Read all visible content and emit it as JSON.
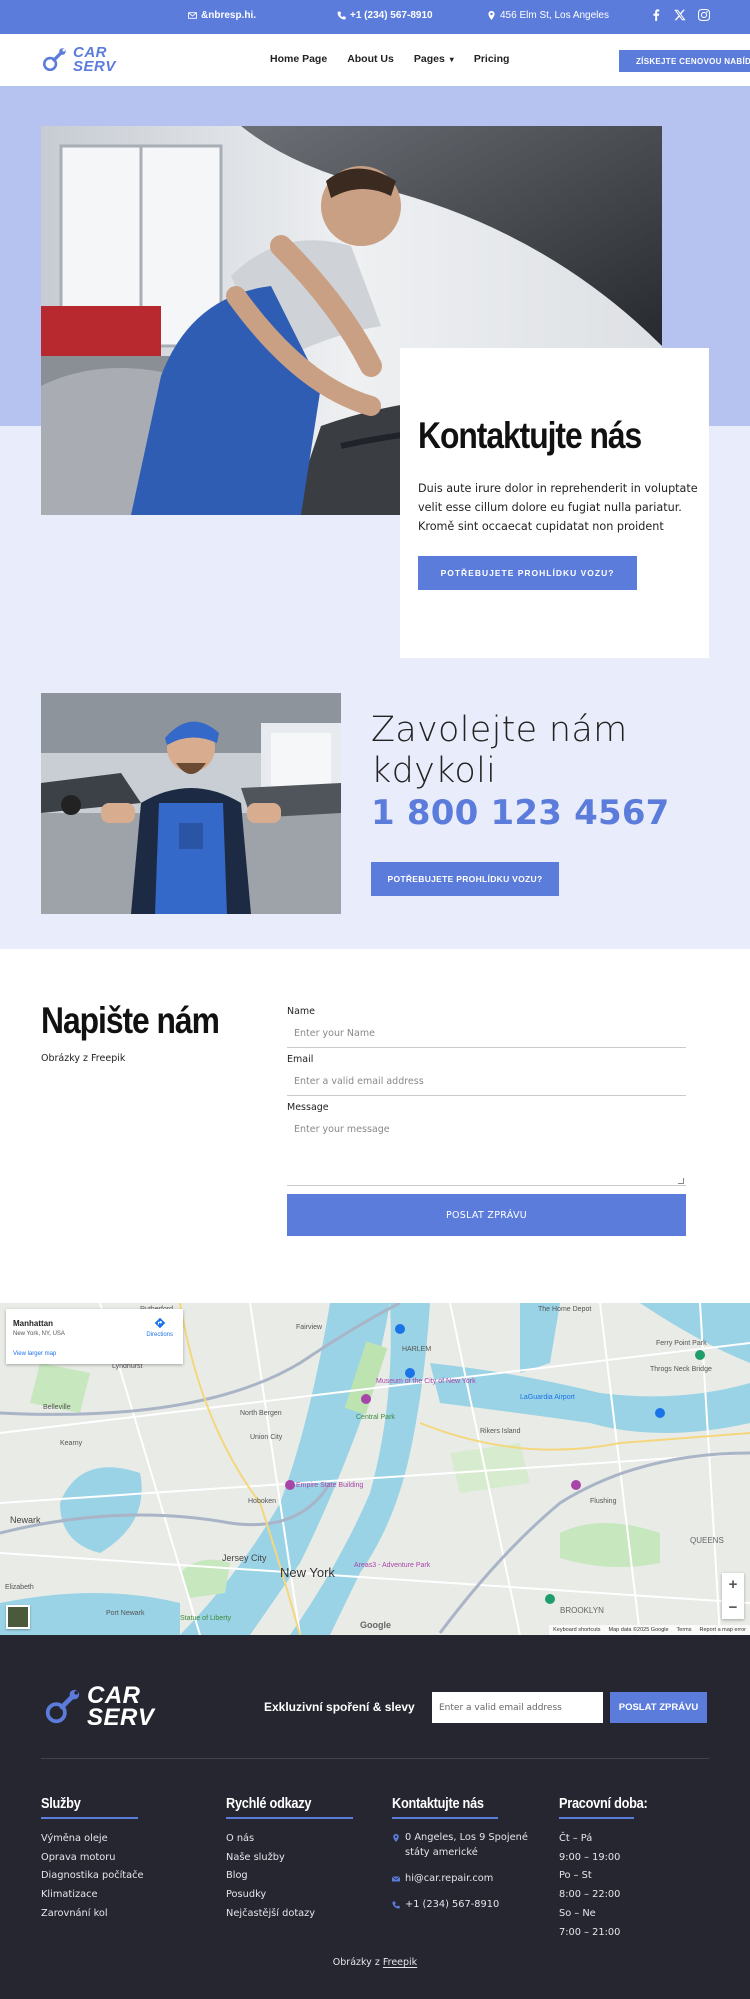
{
  "colors": {
    "accent": "#5c7cdb",
    "hero_band": "#b6c3f0",
    "light_band": "#e9edfb",
    "footer_bg": "#25262f"
  },
  "topbar": {
    "email": "&nbresp.hi.",
    "phone": "+1 (234) 567-8910",
    "address": "456 Elm St, Los Angeles",
    "social": [
      "facebook-icon",
      "x-icon",
      "instagram-icon"
    ]
  },
  "header": {
    "logo_line1": "CAR",
    "logo_line2": "SERV",
    "nav": [
      {
        "label": "Home Page"
      },
      {
        "label": "About Us"
      },
      {
        "label": "Pages",
        "has_dropdown": true
      },
      {
        "label": "Pricing"
      }
    ],
    "cta_label": "ZÍSKEJTE CENOVOU NABÍDKU"
  },
  "hero": {
    "title": "Kontaktujte nás",
    "text": "Duis aute irure dolor in reprehenderit in voluptate velit esse cillum dolore eu fugiat nulla pariatur. Kromě sint occaecat cupidatat non proident",
    "button": "POTŘEBUJETE PROHLÍDKU VOZU?"
  },
  "call": {
    "title_line1": "Zavolejte nám",
    "title_line2": "kdykoli",
    "phone": "1 800 123 4567",
    "button": "POTŘEBUJETE PROHLÍDKU VOZU?"
  },
  "write": {
    "title": "Napište nám",
    "credit": "Obrázky z Freepik",
    "form": {
      "name_label": "Name",
      "name_placeholder": "Enter your Name",
      "email_label": "Email",
      "email_placeholder": "Enter a valid email address",
      "message_label": "Message",
      "message_placeholder": "Enter your message",
      "submit": "POSLAT ZPRÁVU"
    }
  },
  "map": {
    "card_title": "Manhattan",
    "card_subtitle": "New York, NY, USA",
    "card_link": "View larger map",
    "directions": "Directions",
    "labels": [
      "Rutherford",
      "Fairview",
      "HARLEM",
      "The Home Depot",
      "Ferry Point Park",
      "Lyndhurst",
      "Belleville",
      "North Bergen",
      "Kearny",
      "Union City",
      "Newark",
      "Hoboken",
      "Jersey City",
      "New York",
      "QUEENS",
      "BROOKLYN",
      "Elizabeth",
      "Museum of the City of New York",
      "Central Park",
      "Empire State Building",
      "LaGuardia Airport",
      "Flushing",
      "Rikers Island",
      "Areas3 - Adventure Park",
      "Statue of Liberty",
      "Throgs Neck Bridge",
      "Port Newark"
    ],
    "google": "Google",
    "footer_items": [
      "Keyboard shortcuts",
      "Map data ©2025 Google",
      "Terms",
      "Report a map error"
    ]
  },
  "footer": {
    "logo_line1": "CAR",
    "logo_line2": "SERV",
    "newsletter_label": "Exkluzivní spoření & slevy",
    "newsletter_placeholder": "Enter a valid email address",
    "newsletter_button": "POSLAT ZPRÁVU",
    "services_title": "Služby",
    "services": [
      "Výměna oleje",
      "Oprava motoru",
      "Diagnostika počítače",
      "Klimatizace",
      "Zarovnání kol"
    ],
    "links_title": "Rychlé odkazy",
    "links": [
      "O nás",
      "Naše služby",
      "Blog",
      "Posudky",
      "Nejčastější dotazy"
    ],
    "contact_title": "Kontaktujte nás",
    "contact_address": "0 Angeles, Los 9 Spojené státy americké",
    "contact_email": "hi@car.repair.com",
    "contact_phone": "+1 (234) 567-8910",
    "hours_title": "Pracovní doba:",
    "hours": [
      "Čt – Pá",
      "9:00 – 19:00",
      "Po – St",
      "8:00 – 22:00",
      "So – Ne",
      "7:00 – 21:00"
    ],
    "credit_prefix": "Obrázky z",
    "credit_link": "Freepik"
  }
}
